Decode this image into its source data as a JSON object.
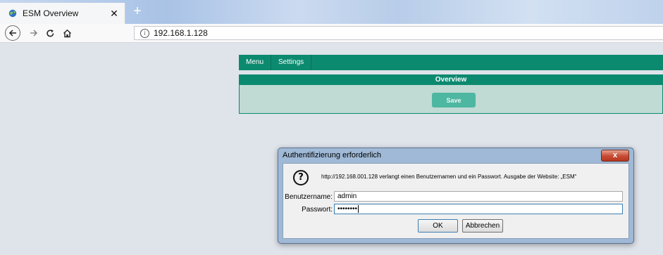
{
  "browser": {
    "tab_title": "ESM Overview",
    "close_glyph": "✕",
    "new_tab_glyph": "+",
    "url": "192.168.1.128",
    "icons": [
      "back-icon",
      "forward-icon",
      "reload-icon",
      "home-icon",
      "info-icon"
    ]
  },
  "page": {
    "menu_items": [
      "Menu",
      "Settings"
    ],
    "overview_title": "Overview",
    "save_label": "Save",
    "colors": {
      "primary": "#0c8a70",
      "panel": "#bfdbd3",
      "save": "#4db7a2"
    }
  },
  "dialog": {
    "title": "Authentifizierung erforderlich",
    "close_glyph": "x",
    "message": "http://192.168.001.128 verlangt einen Benutzernamen und ein Passwort. Ausgabe der Website: „ESM“",
    "username_label": "Benutzername:",
    "username_value": "admin",
    "password_label": "Passwort:",
    "password_mask": "••••••••",
    "ok_label": "OK",
    "cancel_label": "Abbrechen"
  }
}
